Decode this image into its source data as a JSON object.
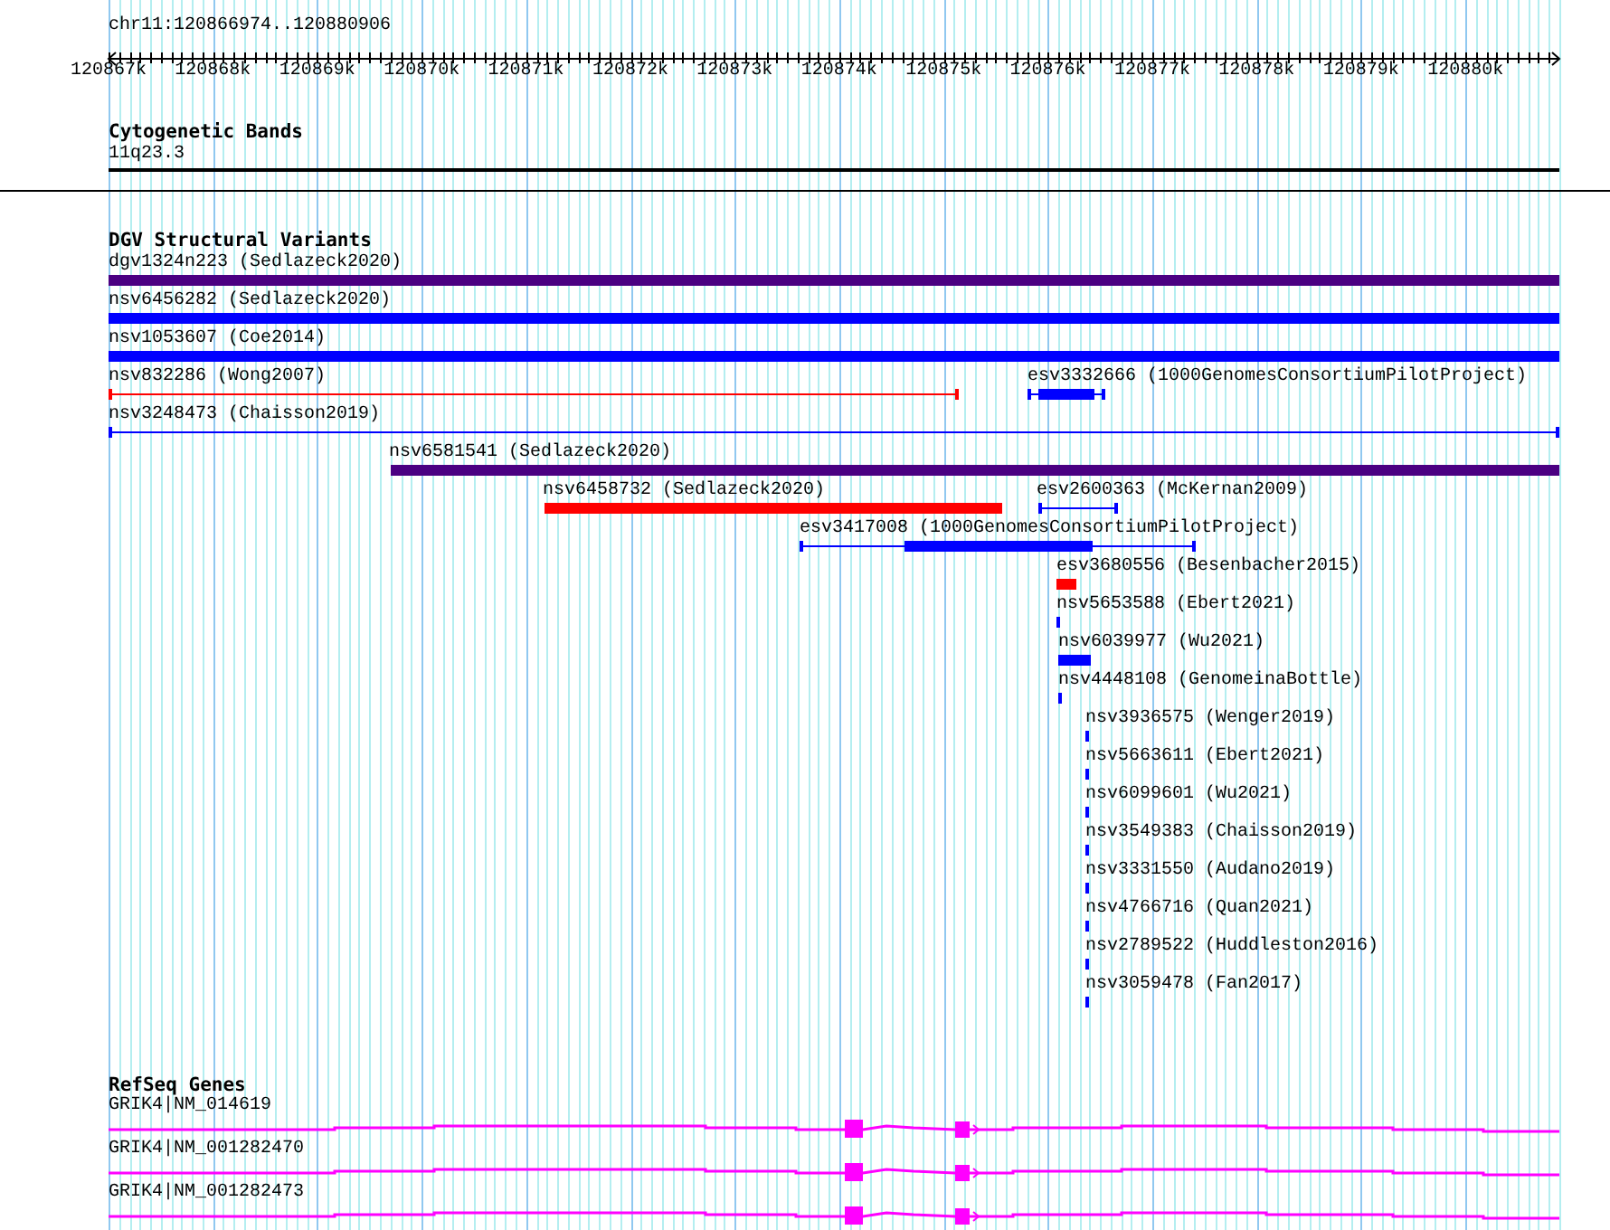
{
  "ruler": {
    "location": "chr11:120866974..120880906",
    "ticks": [
      "120867k",
      "120868k",
      "120869k",
      "120870k",
      "120871k",
      "120872k",
      "120873k",
      "120874k",
      "120875k",
      "120876k",
      "120877k",
      "120878k",
      "120879k",
      "120880k"
    ]
  },
  "tracks": [
    {
      "kind": "cytoband",
      "title": "Cytogenetic Bands",
      "features": [
        {
          "label": "11q23.3"
        }
      ]
    },
    {
      "kind": "variants",
      "title": "DGV Structural Variants",
      "features": [
        {
          "label": "dgv1324n223 (Sedlazeck2020)",
          "color": "#4b0082"
        },
        {
          "label": "nsv6456282 (Sedlazeck2020)",
          "color": "#0000ff"
        },
        {
          "label": "nsv1053607 (Coe2014)",
          "color": "#0000ff"
        },
        {
          "label": "nsv832286 (Wong2007)",
          "color": "#ff0000"
        },
        {
          "label": "esv3332666 (1000GenomesConsortiumPilotProject)",
          "color": "#0000ff"
        },
        {
          "label": "nsv3248473 (Chaisson2019)",
          "color": "#0000ff"
        },
        {
          "label": "nsv6581541 (Sedlazeck2020)",
          "color": "#4b0082"
        },
        {
          "label": "nsv6458732 (Sedlazeck2020)",
          "color": "#ff0000"
        },
        {
          "label": "esv2600363 (McKernan2009)",
          "color": "#0000ff"
        },
        {
          "label": "esv3417008 (1000GenomesConsortiumPilotProject)",
          "color": "#0000ff"
        },
        {
          "label": "esv3680556 (Besenbacher2015)",
          "color": "#ff0000"
        },
        {
          "label": "nsv5653588 (Ebert2021)",
          "color": "#0000ff"
        },
        {
          "label": "nsv6039977 (Wu2021)",
          "color": "#0000ff"
        },
        {
          "label": "nsv4448108 (GenomeinaBottle)",
          "color": "#0000ff"
        },
        {
          "label": "nsv3936575 (Wenger2019)",
          "color": "#0000ff"
        },
        {
          "label": "nsv5663611 (Ebert2021)",
          "color": "#0000ff"
        },
        {
          "label": "nsv6099601 (Wu2021)",
          "color": "#0000ff"
        },
        {
          "label": "nsv3549383 (Chaisson2019)",
          "color": "#0000ff"
        },
        {
          "label": "nsv3331550 (Audano2019)",
          "color": "#0000ff"
        },
        {
          "label": "nsv4766716 (Quan2021)",
          "color": "#0000ff"
        },
        {
          "label": "nsv2789522 (Huddleston2016)",
          "color": "#0000ff"
        },
        {
          "label": "nsv3059478 (Fan2017)",
          "color": "#0000ff"
        }
      ]
    },
    {
      "kind": "genes",
      "title": "RefSeq Genes",
      "features": [
        {
          "label": "GRIK4|NM_014619"
        },
        {
          "label": "GRIK4|NM_001282470"
        },
        {
          "label": "GRIK4|NM_001282473"
        }
      ]
    }
  ]
}
